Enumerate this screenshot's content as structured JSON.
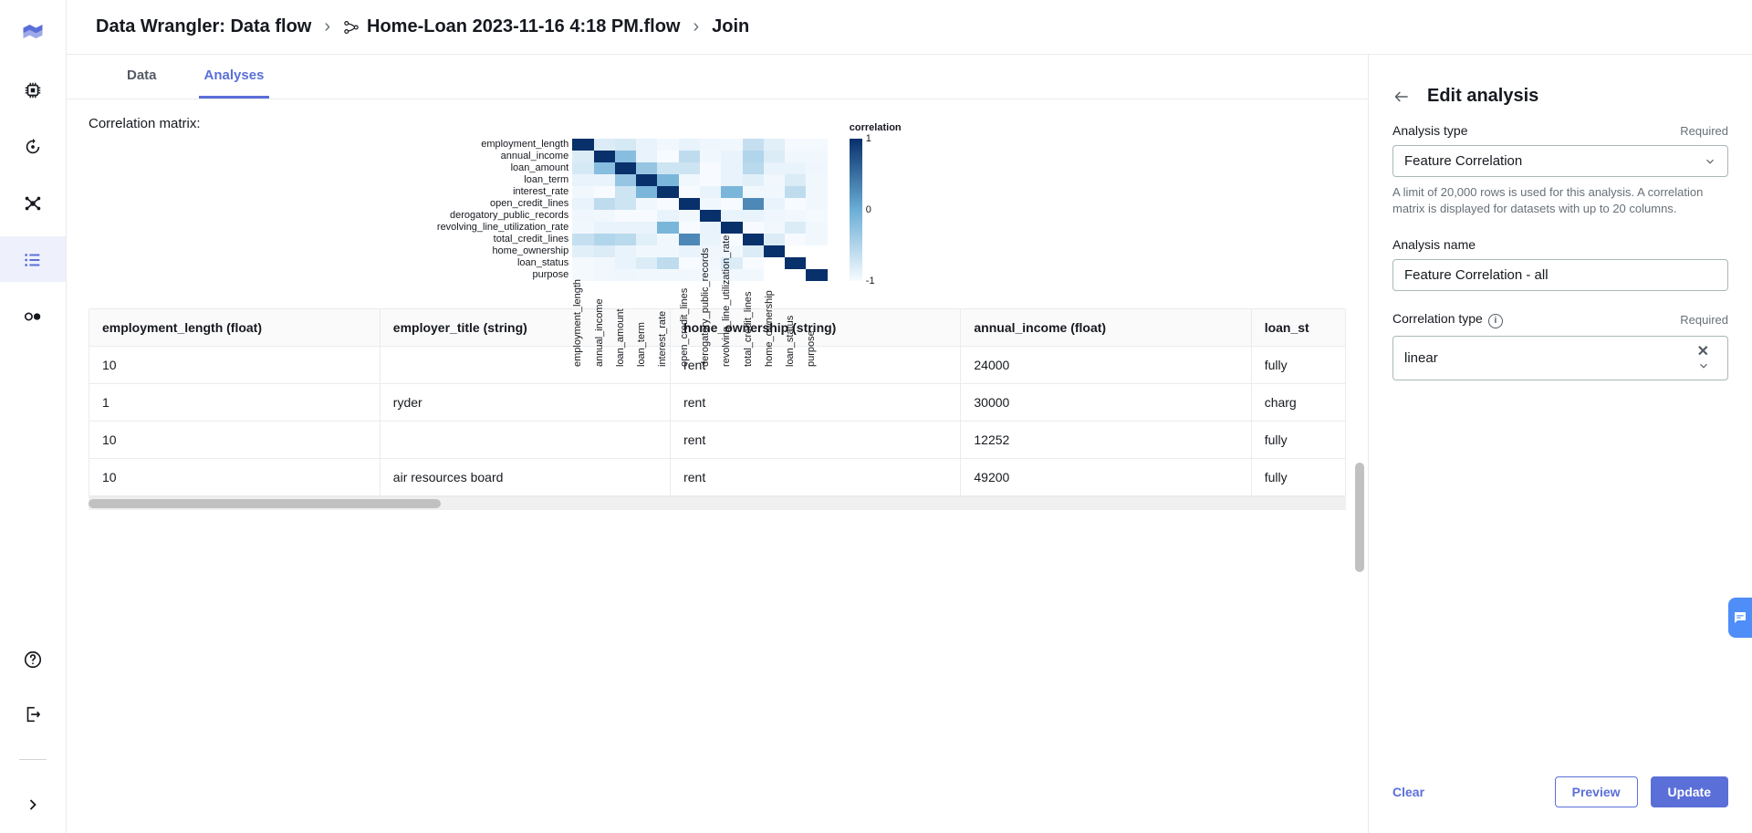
{
  "breadcrumbs": {
    "root": "Data Wrangler: Data flow",
    "file": "Home-Loan 2023-11-16 4:18 PM.flow",
    "step": "Join"
  },
  "tabs": {
    "data": "Data",
    "analyses": "Analyses"
  },
  "section_title": "Correlation matrix:",
  "chart_data": {
    "type": "heatmap",
    "legend_title": "correlation",
    "y": [
      "employment_length",
      "annual_income",
      "loan_amount",
      "loan_term",
      "interest_rate",
      "open_credit_lines",
      "derogatory_public_records",
      "revolving_line_utilization_rate",
      "total_credit_lines",
      "home_ownership",
      "loan_status",
      "purpose"
    ],
    "x": [
      "employment_length",
      "annual_income",
      "loan_amount",
      "loan_term",
      "interest_rate",
      "open_credit_lines",
      "derogatory_public_records",
      "revolving_line_utilization_rate",
      "total_credit_lines",
      "home_ownership",
      "loan_status",
      "purpose"
    ],
    "values": [
      [
        1.0,
        0.1,
        0.12,
        0.05,
        0.02,
        0.05,
        0.03,
        0.02,
        0.18,
        0.08,
        0.01,
        0.01
      ],
      [
        0.1,
        1.0,
        0.4,
        0.05,
        0.0,
        0.2,
        0.02,
        0.05,
        0.25,
        0.1,
        0.02,
        0.02
      ],
      [
        0.12,
        0.4,
        1.0,
        0.35,
        0.15,
        0.15,
        0.0,
        0.05,
        0.22,
        0.05,
        0.05,
        0.03
      ],
      [
        0.05,
        0.05,
        0.35,
        1.0,
        0.45,
        0.02,
        0.0,
        0.05,
        0.08,
        0.02,
        0.1,
        0.02
      ],
      [
        0.02,
        0.0,
        0.15,
        0.45,
        1.0,
        0.0,
        0.05,
        0.45,
        0.02,
        0.02,
        0.2,
        0.02
      ],
      [
        0.05,
        0.2,
        0.15,
        0.02,
        0.0,
        1.0,
        0.02,
        0.0,
        0.65,
        0.05,
        0.0,
        0.02
      ],
      [
        0.03,
        0.02,
        0.0,
        0.0,
        0.05,
        0.02,
        1.0,
        0.05,
        0.05,
        0.03,
        0.02,
        0.01
      ],
      [
        0.02,
        0.05,
        0.05,
        0.05,
        0.45,
        0.0,
        0.05,
        1.0,
        0.0,
        0.02,
        0.1,
        0.02
      ],
      [
        0.18,
        0.25,
        0.22,
        0.08,
        0.02,
        0.65,
        0.05,
        0.0,
        1.0,
        0.1,
        0.0,
        0.02
      ],
      [
        0.08,
        0.1,
        0.05,
        0.02,
        0.02,
        0.05,
        0.03,
        0.02,
        0.1,
        1.0,
        null,
        null
      ],
      [
        0.01,
        0.02,
        0.05,
        0.1,
        0.2,
        0.0,
        0.02,
        0.1,
        0.0,
        null,
        1.0,
        null
      ],
      [
        0.01,
        0.02,
        0.03,
        0.02,
        0.02,
        0.02,
        0.01,
        0.02,
        0.02,
        null,
        null,
        1.0
      ]
    ],
    "legend_ticks": [
      "1",
      "0",
      "-1"
    ]
  },
  "table": {
    "columns": [
      "employment_length (float)",
      "employer_title (string)",
      "home_ownership (string)",
      "annual_income (float)",
      "loan_st"
    ],
    "rows": [
      [
        "10",
        "",
        "rent",
        "24000",
        "fully"
      ],
      [
        "1",
        "ryder",
        "rent",
        "30000",
        "charg"
      ],
      [
        "10",
        "",
        "rent",
        "12252",
        "fully"
      ],
      [
        "10",
        "air resources board",
        "rent",
        "49200",
        "fully"
      ]
    ]
  },
  "right_panel": {
    "title": "Edit analysis",
    "analysis_type_label": "Analysis type",
    "required": "Required",
    "analysis_type_value": "Feature Correlation",
    "analysis_type_help": "A limit of 20,000 rows is used for this analysis. A correlation matrix is displayed for datasets with up to 20 columns.",
    "analysis_name_label": "Analysis name",
    "analysis_name_value": "Feature Correlation - all",
    "corr_type_label": "Correlation type",
    "corr_type_value": "linear",
    "clear": "Clear",
    "preview": "Preview",
    "update": "Update"
  }
}
